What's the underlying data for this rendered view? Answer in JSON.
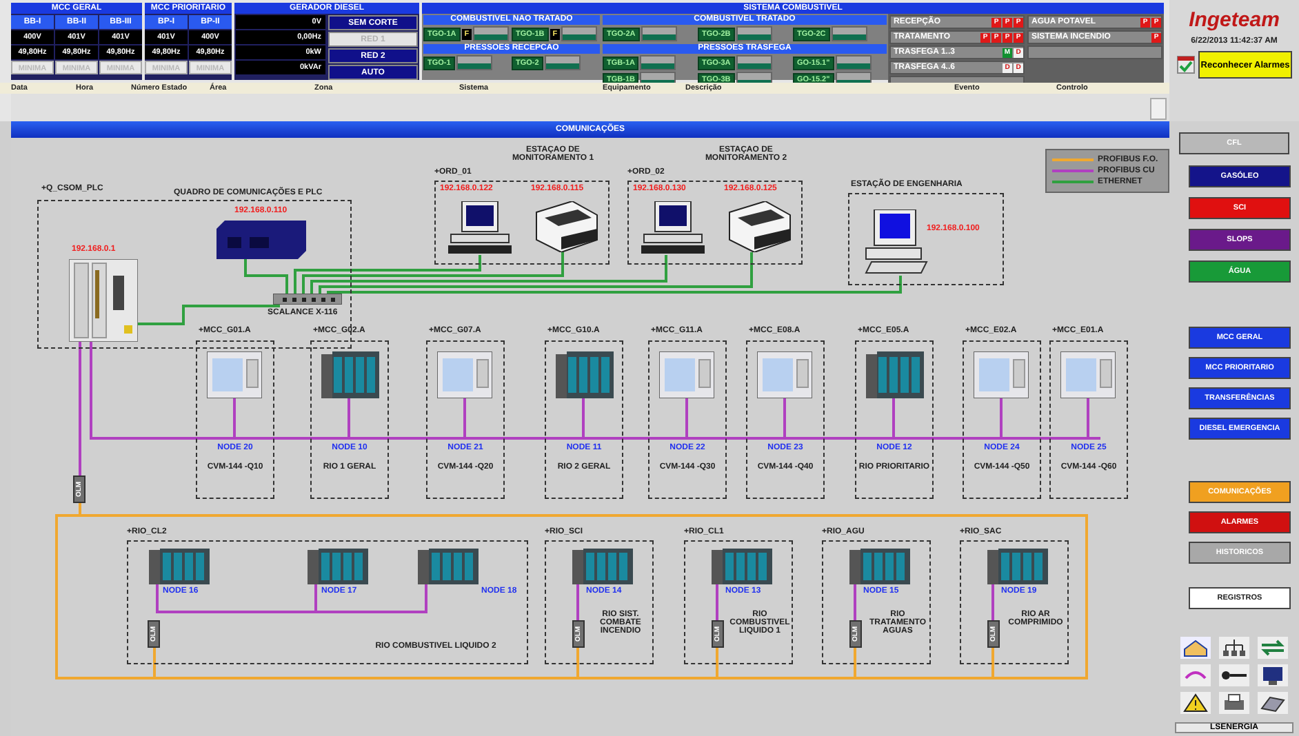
{
  "header": {
    "mcc_geral": {
      "title": "MCC GERAL",
      "bars": [
        {
          "name": "BB-I",
          "voltage": "400V",
          "frequency": "49,80Hz",
          "mode": "MINIMA"
        },
        {
          "name": "BB-II",
          "voltage": "401V",
          "frequency": "49,80Hz",
          "mode": "MINIMA"
        },
        {
          "name": "BB-III",
          "voltage": "401V",
          "frequency": "49,80Hz",
          "mode": "MINIMA"
        }
      ]
    },
    "mcc_prioritario": {
      "title": "MCC PRIORITARIO",
      "bars": [
        {
          "name": "BP-I",
          "voltage": "401V",
          "frequency": "49,80Hz",
          "mode": "MINIMA"
        },
        {
          "name": "BP-II",
          "voltage": "400V",
          "frequency": "49,80Hz",
          "mode": "MINIMA"
        }
      ]
    },
    "gerador_diesel": {
      "title": "GERADOR DIESEL",
      "readings": [
        "0V",
        "0,00Hz",
        "0kW",
        "0kVAr"
      ],
      "modes": [
        {
          "label": "SEM CORTE",
          "active": true
        },
        {
          "label": "RED 1",
          "active": false
        },
        {
          "label": "RED 2",
          "active": true
        },
        {
          "label": "AUTO",
          "active": true
        }
      ]
    },
    "sistema_combustivel": {
      "title": "SISTEMA COMBUSTIVEL",
      "sections": [
        {
          "title": "COMBUSTIVEL NAO TRATADO",
          "tags": [
            {
              "label": "TGO-1A",
              "flag": "F"
            },
            {
              "label": "TGO-1B",
              "flag": "F"
            }
          ]
        },
        {
          "title": "COMBUSTIVEL TRATADO",
          "tags": [
            {
              "label": "TGO-2A"
            },
            {
              "label": "TGO-2B"
            },
            {
              "label": "TGO-2C"
            }
          ]
        },
        {
          "title": "PRESSOES RECEPCAO",
          "tags": [
            {
              "label": "TGO-1"
            },
            {
              "label": "TGO-2"
            }
          ]
        },
        {
          "title": "PRESSOES TRASFEGA",
          "tags": [
            {
              "label": "TGB-1A"
            },
            {
              "label": "TGO-3A"
            },
            {
              "label": "GO-15.1\""
            },
            {
              "label": "TGB-1B"
            },
            {
              "label": "TGO-3B"
            },
            {
              "label": "GO-15.2\""
            }
          ]
        }
      ]
    },
    "status": {
      "left": [
        {
          "label": "RECEPÇÃO",
          "flags": [
            {
              "text": "P",
              "color": "#e01818"
            },
            {
              "text": "P",
              "color": "#e01818"
            },
            {
              "text": "P",
              "color": "#e01818"
            }
          ]
        },
        {
          "label": "TRATAMENTO",
          "flags": [
            {
              "text": "P",
              "color": "#e01818"
            },
            {
              "text": "P",
              "color": "#e01818"
            },
            {
              "text": "P",
              "color": "#e01818"
            },
            {
              "text": "P",
              "color": "#e01818"
            }
          ]
        },
        {
          "label": "TRASFEGA 1..3",
          "flags": [
            {
              "text": "M",
              "color": "#109030"
            },
            {
              "text": "D",
              "color": "#f0f0f0"
            }
          ]
        },
        {
          "label": "TRASFEGA 4..6",
          "flags": [
            {
              "text": "D",
              "color": "#f0f0f0"
            },
            {
              "text": "D",
              "color": "#f0f0f0"
            }
          ]
        }
      ],
      "right": [
        {
          "label": "AGUA POTAVEL",
          "flags": [
            {
              "text": "P",
              "color": "#e01818"
            },
            {
              "text": "P",
              "color": "#e01818"
            }
          ]
        },
        {
          "label": "SISTEMA INCENDIO",
          "flags": [
            {
              "text": "P",
              "color": "#e01818"
            }
          ]
        }
      ]
    },
    "alarm_columns": [
      "Data",
      "Hora",
      "Número Estado",
      "Área",
      "Zona",
      "Sistema",
      "Equipamento",
      "Descrição",
      "Evento",
      "Controlo"
    ]
  },
  "brand": {
    "logo": "Ingeteam",
    "datetime": "6/22/2013 11:42:37 AM",
    "acknowledge_button": "Reconhecer Alarmes"
  },
  "screen_title": "COMUNICAÇÕES",
  "diagram": {
    "legend": [
      {
        "label": "PROFIBUS F.O.",
        "color": "#f0a830"
      },
      {
        "label": "PROFIBUS CU",
        "color": "#b040c0"
      },
      {
        "label": "ETHERNET",
        "color": "#30a040"
      }
    ],
    "plc_panel": {
      "tag": "+Q_CSOM_PLC",
      "title": "QUADRO DE COMUNICAÇÕES E PLC",
      "plc_ip": "192.168.0.1",
      "switch_ip": "192.168.0.110",
      "switch_label": "SCALANCE X-116"
    },
    "stations": [
      {
        "tag": "+ORD_01",
        "title": "ESTAÇAO DE MONITORAMENTO 1",
        "pc_ip": "192.168.0.122",
        "printer_ip": "192.168.0.115"
      },
      {
        "tag": "+ORD_02",
        "title": "ESTAÇAO DE MONITORAMENTO 2",
        "pc_ip": "192.168.0.130",
        "printer_ip": "192.168.0.125"
      }
    ],
    "engineering": {
      "title": "ESTAÇÃO DE ENGENHARIA",
      "ip": "192.168.0.100"
    },
    "olm_label": "OLM",
    "mcc_nodes": [
      {
        "tag": "+MCC_G01.A",
        "kind": "meter",
        "node": "NODE 20",
        "description": "CVM-144 -Q10"
      },
      {
        "tag": "+MCC_G02.A",
        "kind": "rio",
        "node": "NODE 10",
        "description": "RIO 1 GERAL"
      },
      {
        "tag": "+MCC_G07.A",
        "kind": "meter",
        "node": "NODE 21",
        "description": "CVM-144 -Q20"
      },
      {
        "tag": "+MCC_G10.A",
        "kind": "rio",
        "node": "NODE 11",
        "description": "RIO 2 GERAL"
      },
      {
        "tag": "+MCC_G11.A",
        "kind": "meter",
        "node": "NODE 22",
        "description": "CVM-144 -Q30"
      },
      {
        "tag": "+MCC_E08.A",
        "kind": "meter",
        "node": "NODE 23",
        "description": "CVM-144 -Q40"
      },
      {
        "tag": "+MCC_E05.A",
        "kind": "rio",
        "node": "NODE 12",
        "description": "RIO PRIORITARIO"
      },
      {
        "tag": "+MCC_E02.A",
        "kind": "meter",
        "node": "NODE 24",
        "description": "CVM-144 -Q50"
      },
      {
        "tag": "+MCC_E01.A",
        "kind": "meter",
        "node": "NODE 25",
        "description": "CVM-144 -Q60"
      }
    ],
    "rio_groups": [
      {
        "tag": "+RIO_CL2",
        "nodes": [
          "NODE 16",
          "NODE 17",
          "NODE 18"
        ],
        "description": "RIO COMBUSTIVEL LIQUIDO 2",
        "olm": "OLM"
      },
      {
        "tag": "+RIO_SCI",
        "nodes": [
          "NODE 14"
        ],
        "description": "RIO SIST. COMBATE INCENDIO",
        "olm": "OLM"
      },
      {
        "tag": "+RIO_CL1",
        "nodes": [
          "NODE 13"
        ],
        "description": "RIO COMBUSTIVEL LIQUIDO 1",
        "olm": "OLM"
      },
      {
        "tag": "+RIO_AGU",
        "nodes": [
          "NODE 15"
        ],
        "description": "RIO TRATAMENTO AGUAS",
        "olm": "OLM"
      },
      {
        "tag": "+RIO_SAC",
        "nodes": [
          "NODE 19"
        ],
        "description": "RIO AR COMPRIMIDO",
        "olm": "OLM"
      }
    ]
  },
  "sidebar": {
    "top_button": "CFL",
    "process_buttons": [
      {
        "label": "GASÓLEO",
        "color": "#14148a"
      },
      {
        "label": "SCI",
        "color": "#e01010"
      },
      {
        "label": "SLOPS",
        "color": "#6a1a8a"
      },
      {
        "label": "ÁGUA",
        "color": "#189a38"
      }
    ],
    "mcc_buttons": [
      {
        "label": "MCC GERAL",
        "color": "#1a3ae0"
      },
      {
        "label": "MCC PRIORITARIO",
        "color": "#1a3ae0"
      },
      {
        "label": "TRANSFERÊNCIAS",
        "color": "#1a3ae0"
      },
      {
        "label": "DIESEL EMERGENCIA",
        "color": "#1a3ae0"
      }
    ],
    "view_buttons": [
      {
        "label": "COMUNICAÇÕES",
        "color": "#f0a020"
      },
      {
        "label": "ALARMES",
        "color": "#d01010"
      },
      {
        "label": "HISTORICOS",
        "color": "#a8a8a8"
      }
    ],
    "records_button": "REGISTROS",
    "footer": "LSENERGIA"
  }
}
